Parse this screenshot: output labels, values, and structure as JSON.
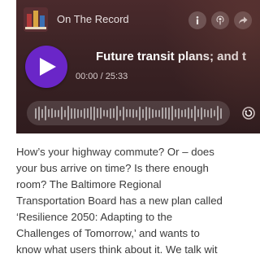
{
  "player": {
    "show_name": "On The Record",
    "episode_title": "Future transit plans; and t",
    "current_time": "00:00",
    "duration": "25:33",
    "progress": 0,
    "accent_color": "#6a26c8"
  },
  "icons": {
    "info": "info-icon",
    "podcast": "podcast-icon",
    "share": "share-icon",
    "play": "play-icon",
    "replay": "replay-icon"
  },
  "description": {
    "lines": [
      "How’s your highway commute? Or – does",
      "your bus arrive on time? Is there enough",
      "room? The Baltimore Regional",
      "Transportation Board has a new plan called",
      "‘Resilience 2050: Adapting to the",
      "Challenges of Tomorrow,’ and wants to",
      "know what users think about it. We talk wit"
    ]
  }
}
